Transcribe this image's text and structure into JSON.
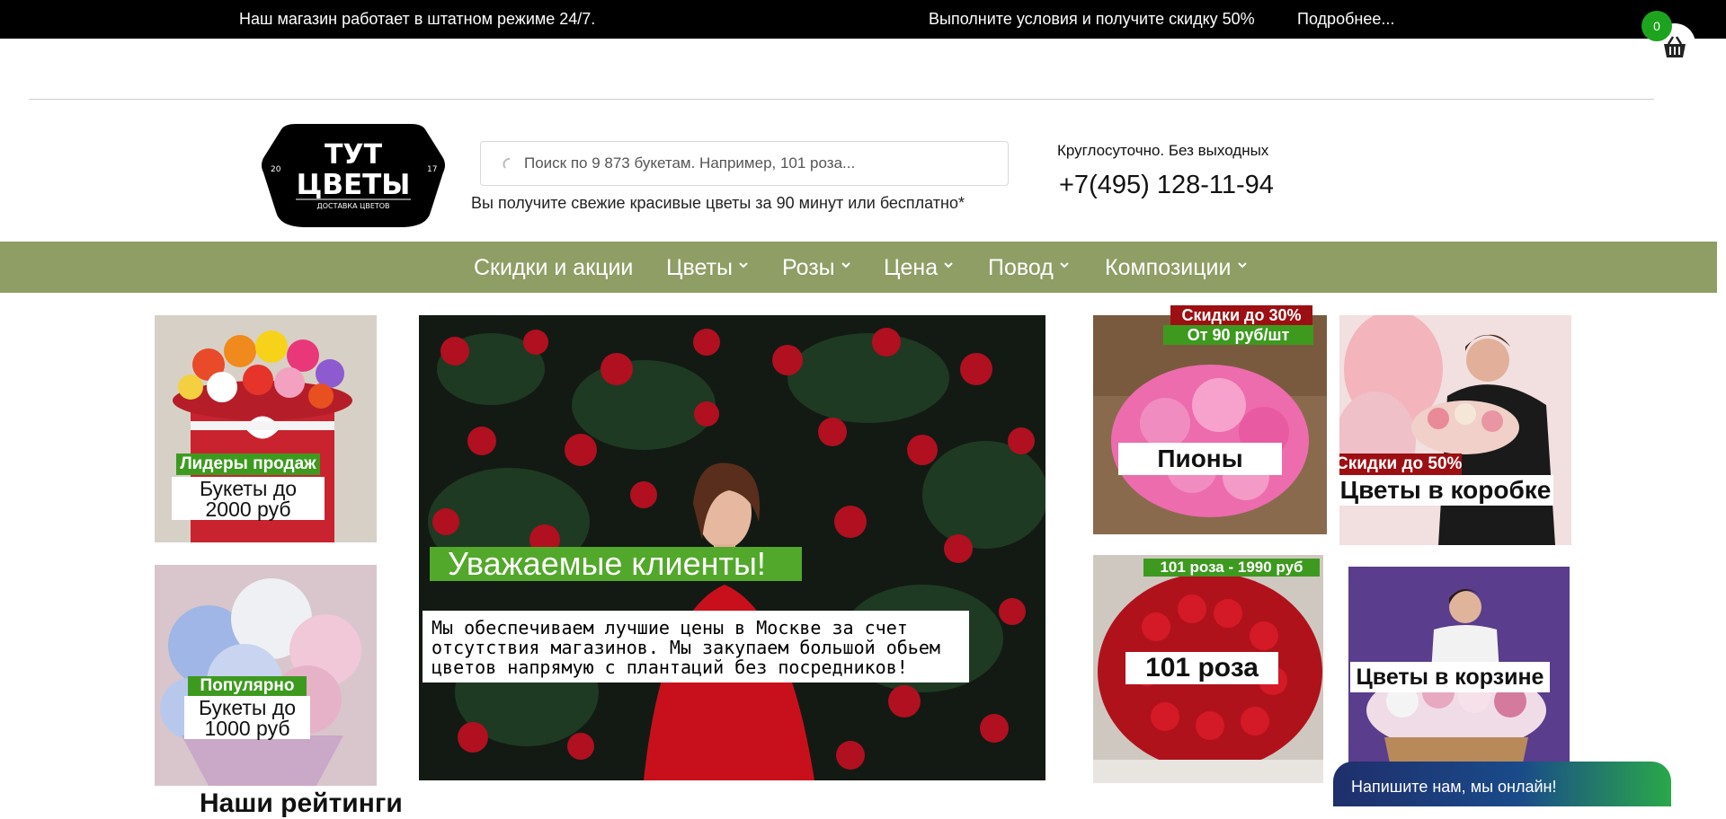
{
  "topbar": {
    "left_text": "Наш магазин работает в штатном режиме 24/7.",
    "promo_text": "Выполните условия и получите скидку 50%",
    "more_link": "Подробнее..."
  },
  "cart": {
    "count": "0",
    "icon": "basket-icon"
  },
  "logo": {
    "line1": "ТУТ",
    "line2": "ЦВЕТЫ",
    "sub": "ДОСТАВКА ЦВЕТОВ",
    "year_left": "20",
    "year_right": "17"
  },
  "search": {
    "placeholder": "Поиск по 9 873 букетам. Например, 101 роза..."
  },
  "tagline": "Вы получите свежие красивые цветы за 90 минут или бесплатно*",
  "contact": {
    "hours": "Круглосуточно. Без выходных",
    "phone": "+7(495) 128-11-94"
  },
  "nav": {
    "items": [
      {
        "label": "Скидки и акции"
      },
      {
        "label": "Цветы"
      },
      {
        "label": "Розы"
      },
      {
        "label": "Цена"
      },
      {
        "label": "Повод"
      },
      {
        "label": "Композиции"
      }
    ]
  },
  "tiles": {
    "leaders": {
      "badge": "Лидеры продаж",
      "line1": "Букеты до",
      "line2": "2000 руб"
    },
    "popular": {
      "badge": "Популярно",
      "line1": "Букеты до",
      "line2": "1000 руб"
    },
    "peonies": {
      "badge_red": "Скидки до 30%",
      "badge_green": "От 90 руб/шт",
      "title": "Пионы"
    },
    "box": {
      "badge_red": "Скидки до 50%",
      "title": "Цветы в коробке"
    },
    "roses101": {
      "badge": "101 роза - 1990 руб",
      "title": "101 роза"
    },
    "basket": {
      "title": "Цветы в корзине"
    }
  },
  "banner": {
    "title": "Уважаемые клиенты!",
    "lines": [
      "Мы обеспечиваем лучшие цены в Москве за счет",
      "отсутствия магазинов. Мы закупаем большой обьем",
      "цветов напрямую с плантаций без посредников!"
    ]
  },
  "ratings": {
    "title": "Наши рейтинги"
  },
  "chat": {
    "label": "Напишите нам, мы онлайн!"
  },
  "colors": {
    "nav_bg": "#8e9e65",
    "badge_green": "#3d9a1f",
    "badge_red": "#9c0f12",
    "cart_badge": "#1ea31e"
  }
}
